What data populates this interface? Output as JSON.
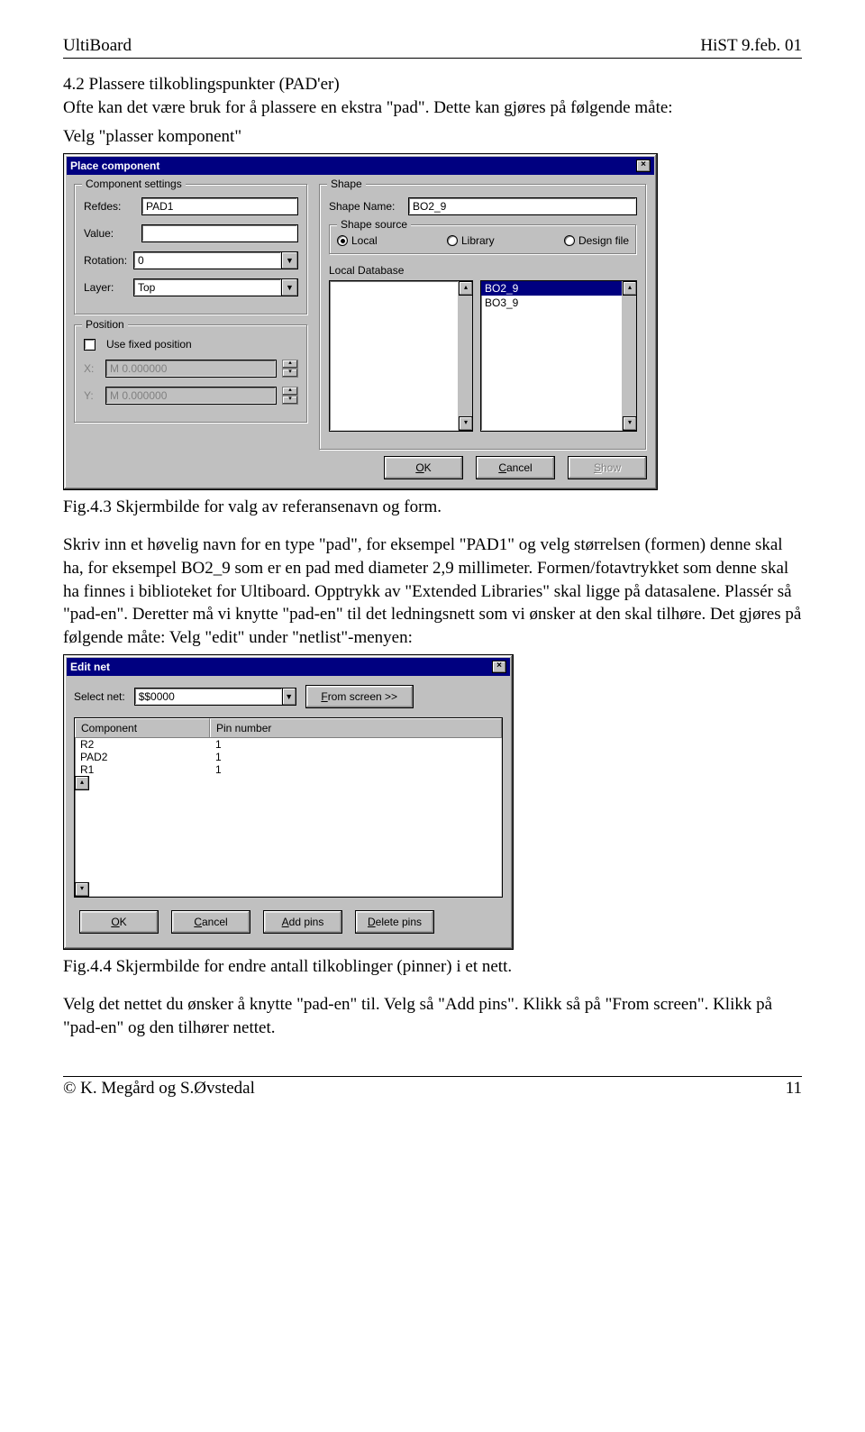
{
  "header": {
    "left": "UltiBoard",
    "right": "HiST 9.feb. 01"
  },
  "section_title": "4.2 Plassere tilkoblingspunkter (PAD'er)",
  "intro_p1": "Ofte kan det være bruk for å plassere en ekstra \"pad\". Dette kan gjøres på følgende måte:",
  "intro_p2": "Velg \"plasser komponent\"",
  "place_dialog": {
    "title": "Place component",
    "close": "×",
    "component_settings": {
      "legend": "Component settings",
      "refdes_label": "Refdes:",
      "refdes_value": "PAD1",
      "value_label": "Value:",
      "value_value": "",
      "rotation_label": "Rotation:",
      "rotation_value": "0",
      "layer_label": "Layer:",
      "layer_value": "Top"
    },
    "position": {
      "legend": "Position",
      "fixed_label": "Use fixed position",
      "x_label": "X:",
      "x_value": "M 0.000000",
      "y_label": "Y:",
      "y_value": "M 0.000000"
    },
    "shape": {
      "legend": "Shape",
      "name_label": "Shape Name:",
      "name_value": "BO2_9",
      "source_legend": "Shape source",
      "source_options": [
        "Local",
        "Library",
        "Design file"
      ],
      "source_selected": 0,
      "localdb_label": "Local Database",
      "left_list": [],
      "right_list": [
        "BO2_9",
        "BO3_9"
      ],
      "right_selected": 0
    },
    "buttons": {
      "ok": "OK",
      "cancel": "Cancel",
      "show": "Show"
    }
  },
  "caption1": "Fig.4.3 Skjermbilde for valg av referansenavn og form.",
  "mid_p1": "Skriv inn et høvelig navn for en type \"pad\", for eksempel \"PAD1\" og velg størrelsen (formen) denne skal ha, for eksempel BO2_9 som er en pad med diameter 2,9 millimeter. Formen/fotavtrykket som denne skal ha finnes i biblioteket for Ultiboard. Opptrykk av \"Extended Libraries\" skal ligge på datasalene. Plassér så \"pad-en\". Deretter må vi knytte \"pad-en\" til det ledningsnett som vi ønsker at den skal tilhøre. Det gjøres på følgende måte: Velg \"edit\" under \"netlist\"-menyen:",
  "edit_dialog": {
    "title": "Edit net",
    "close": "×",
    "select_label": "Select net:",
    "select_value": "$$0000",
    "from_screen": "From screen >>",
    "col_component": "Component",
    "col_pin": "Pin number",
    "rows": [
      {
        "comp": "R2",
        "pin": "1"
      },
      {
        "comp": "PAD2",
        "pin": "1"
      },
      {
        "comp": "R1",
        "pin": "1"
      }
    ],
    "buttons": {
      "ok": "OK",
      "cancel": "Cancel",
      "add": "Add pins",
      "delete": "Delete pins"
    }
  },
  "caption2": "Fig.4.4 Skjermbilde for endre antall tilkoblinger (pinner) i et nett.",
  "end_p": "Velg det nettet du ønsker å knytte \"pad-en\" til. Velg så \"Add pins\". Klikk så på \"From screen\". Klikk på \"pad-en\" og den tilhører nettet.",
  "footer": {
    "left": "© K. Megård og S.Øvstedal",
    "right": "11"
  }
}
